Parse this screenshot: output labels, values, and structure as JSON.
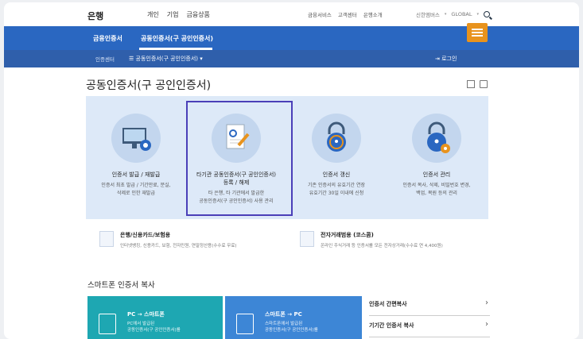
{
  "topbar": {
    "logo": "은행",
    "nav": [
      "개인",
      "기업",
      "금융상품"
    ],
    "util": [
      "금융서비스",
      "고객센터",
      "은행소개"
    ],
    "util2": [
      "신한엠버스",
      "GLOBAL"
    ]
  },
  "nav": {
    "primary": "금융인증서",
    "secondary": "공동인증서(구 공인인증서)",
    "breadcrumb_home": "인증센터",
    "breadcrumb_current": "공동인증서(구 공인인증서)",
    "login": "로그인"
  },
  "page": {
    "title": "공동인증서(구 공인인증서)"
  },
  "services": [
    {
      "title": "인증서 발급 / 재발급",
      "desc1": "인증서 최초 발급 / 기간만료, 분실,",
      "desc2": "삭제로 인한 재발급"
    },
    {
      "title": "타기관 공동인증서(구 공인인증서)",
      "title2": "등록 / 해제",
      "desc1": "타 은행, 타 기관에서 발급한",
      "desc2": "공동인증서(구 공인인증서) 사용 관리"
    },
    {
      "title": "인증서 갱신",
      "desc1": "기존 인증서의 유효기간 연장",
      "desc2": "유효기간 30일 이내에 신청"
    },
    {
      "title": "인증서 관리",
      "desc1": "인증서 복사, 삭제, 비밀번호 변경,",
      "desc2": "백업, 복원 등의 관리"
    }
  ],
  "usage": [
    {
      "title": "은행/신용카드/보험용",
      "desc": "인터넷뱅킹, 신용카드, 보험, 전자민원, 연말정산용(수수료 무료)"
    },
    {
      "title": "전자거래범용 (코스콤)",
      "desc": "온라인 주식거래 등 인증서를 모든 전자상거래(수수료 연 4,400원)"
    }
  ],
  "smart": {
    "section_title": "스마트폰 인증서 복사",
    "box1_title": "PC → 스마트폰",
    "box1_line1": "PC에서 발급된",
    "box1_line2": "공동인증서(구 공인인증서)를",
    "box2_title": "스마트폰 → PC",
    "box2_line1": "스마트폰에서 발급된",
    "box2_line2": "공동인증서(구 공인인증서)를",
    "links": [
      "인증서 간편복사",
      "기기간 인증서 복사"
    ]
  }
}
